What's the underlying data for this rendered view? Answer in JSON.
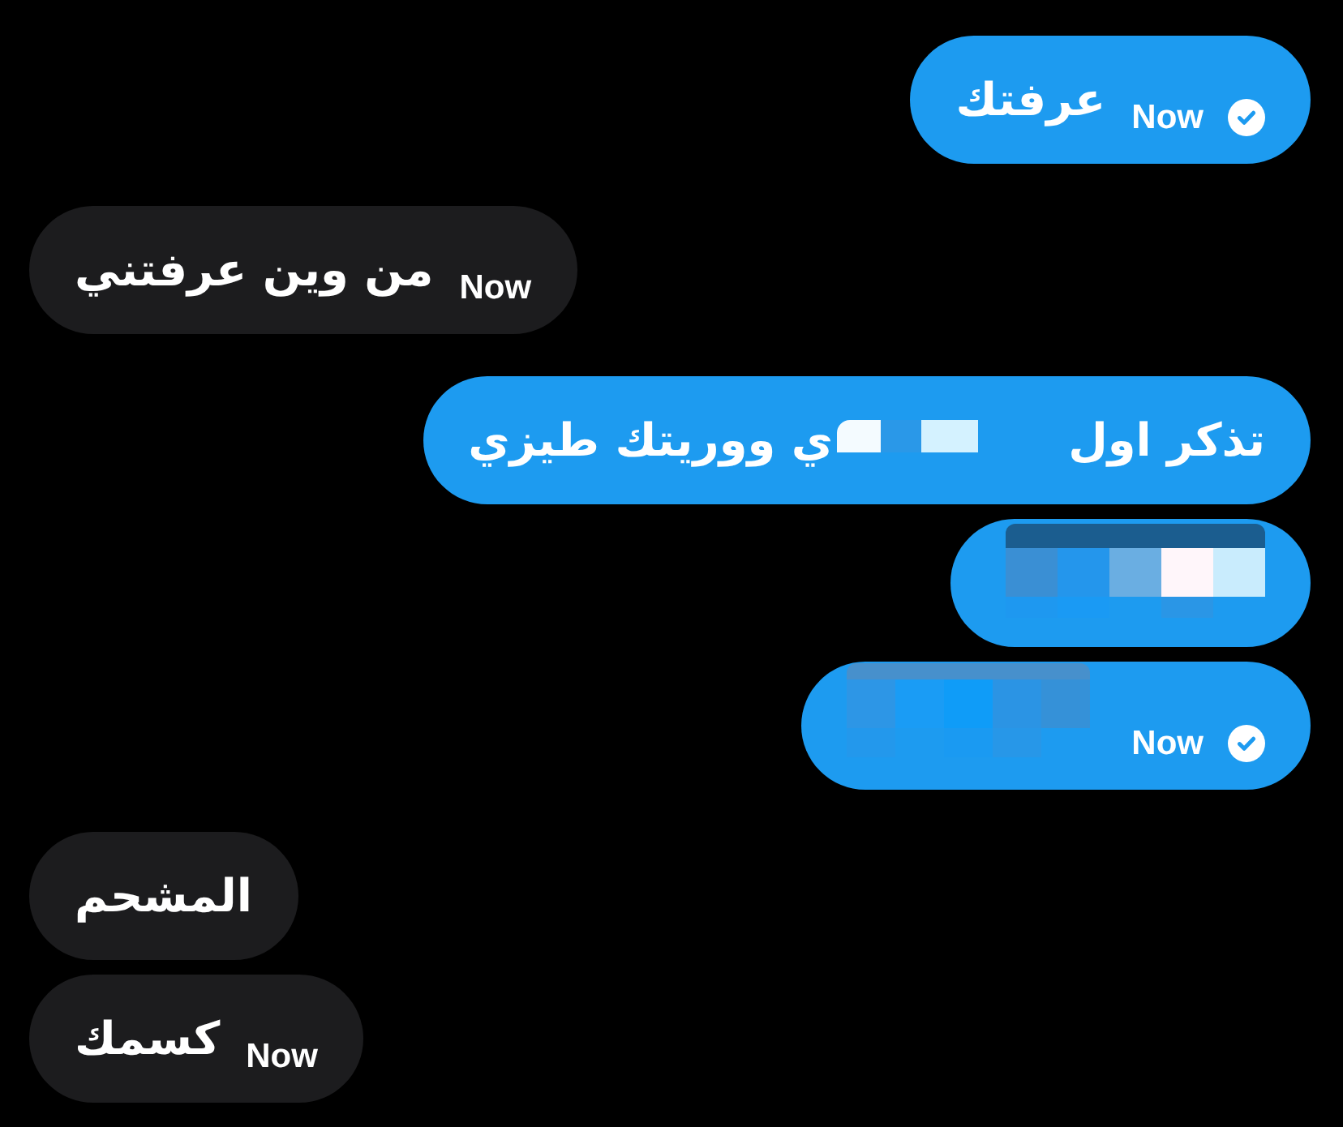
{
  "messages": [
    {
      "kind": "sent",
      "parts": [
        {
          "kind": "text",
          "text": "عرفتك"
        }
      ],
      "time": "Now",
      "delivered": true
    },
    {
      "kind": "received",
      "parts": [
        {
          "kind": "text",
          "text": "من وين عرفتني"
        }
      ],
      "time": "Now"
    },
    {
      "kind": "sent",
      "parts": [
        {
          "kind": "text",
          "text": "تذكر اول"
        },
        {
          "kind": "redacted"
        },
        {
          "kind": "text",
          "text": "ي ووريتك طيزي"
        }
      ]
    },
    {
      "kind": "sent",
      "parts": [
        {
          "kind": "redacted"
        }
      ]
    },
    {
      "kind": "sent",
      "parts": [
        {
          "kind": "redacted"
        }
      ],
      "time": "Now",
      "delivered": true
    },
    {
      "kind": "received",
      "parts": [
        {
          "kind": "text",
          "text": "المشحم"
        }
      ]
    },
    {
      "kind": "received",
      "parts": [
        {
          "kind": "text",
          "text": "كسمك"
        }
      ],
      "time": "Now"
    }
  ]
}
